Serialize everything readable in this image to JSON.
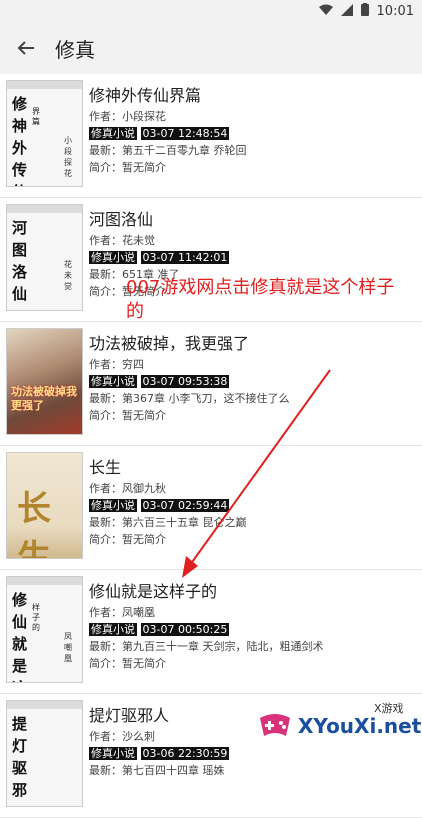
{
  "status": {
    "time": "10:01"
  },
  "appbar": {
    "title": "修真"
  },
  "books": [
    {
      "title": "修神外传仙界篇",
      "author": "作者：小段探花",
      "category": "修真小说",
      "date": "03-07 12:48:54",
      "latest": "最新：第五千二百零九章 乔轮回",
      "intro": "简介：暂无简介",
      "cover": {
        "title": "修神外传仙",
        "sub": "界篇",
        "author": "小段探花"
      }
    },
    {
      "title": "河图洛仙",
      "author": "作者：花未觉",
      "category": "修真小说",
      "date": "03-07 11:42:01",
      "latest": "最新：651章 准了",
      "intro": "简介：暂无简介",
      "cover": {
        "title": "河图洛仙",
        "sub": "",
        "author": "花未觉"
      }
    },
    {
      "title": "功法被破掉，我更强了",
      "author": "作者：穷四",
      "category": "修真小说",
      "date": "03-07 09:53:38",
      "latest": "最新：第367章 小李飞刀，这不接住了么",
      "intro": "简介：暂无简介",
      "cover": {
        "title": "功法被破掉我更强了",
        "sub": "",
        "author": ""
      }
    },
    {
      "title": "长生",
      "author": "作者：风御九秋",
      "category": "修真小说",
      "date": "03-07 02:59:44",
      "latest": "最新：第六百三十五章 昆仑之巅",
      "intro": "简介：暂无简介",
      "cover": {
        "title": "长生",
        "sub": "",
        "author": ""
      }
    },
    {
      "title": "修仙就是这样子的",
      "author": "作者：凤嘲凰",
      "category": "修真小说",
      "date": "03-07 00:50:25",
      "latest": "最新：第九百三十一章 天剑宗，陆北，粗通剑术",
      "intro": "简介：暂无简介",
      "cover": {
        "title": "修仙就是这",
        "sub": "样子的",
        "author": "凤嘲凰"
      }
    },
    {
      "title": "提灯驱邪人",
      "author": "作者：沙么刺",
      "category": "修真小说",
      "date": "03-06 22:30:59",
      "latest": "最新：第七百四十四章 瑶姝",
      "intro": "",
      "cover": {
        "title": "提灯驱邪",
        "sub": "",
        "author": ""
      }
    }
  ],
  "annotation": {
    "text": "007游戏网点击修真就是这个样子的"
  },
  "watermark": {
    "brand_small": "X游戏",
    "brand_big": "XYouXi.net"
  },
  "colors": {
    "annotation": "#e02020",
    "tag_bg": "#111111",
    "bar_bg": "#f2f2f2"
  }
}
